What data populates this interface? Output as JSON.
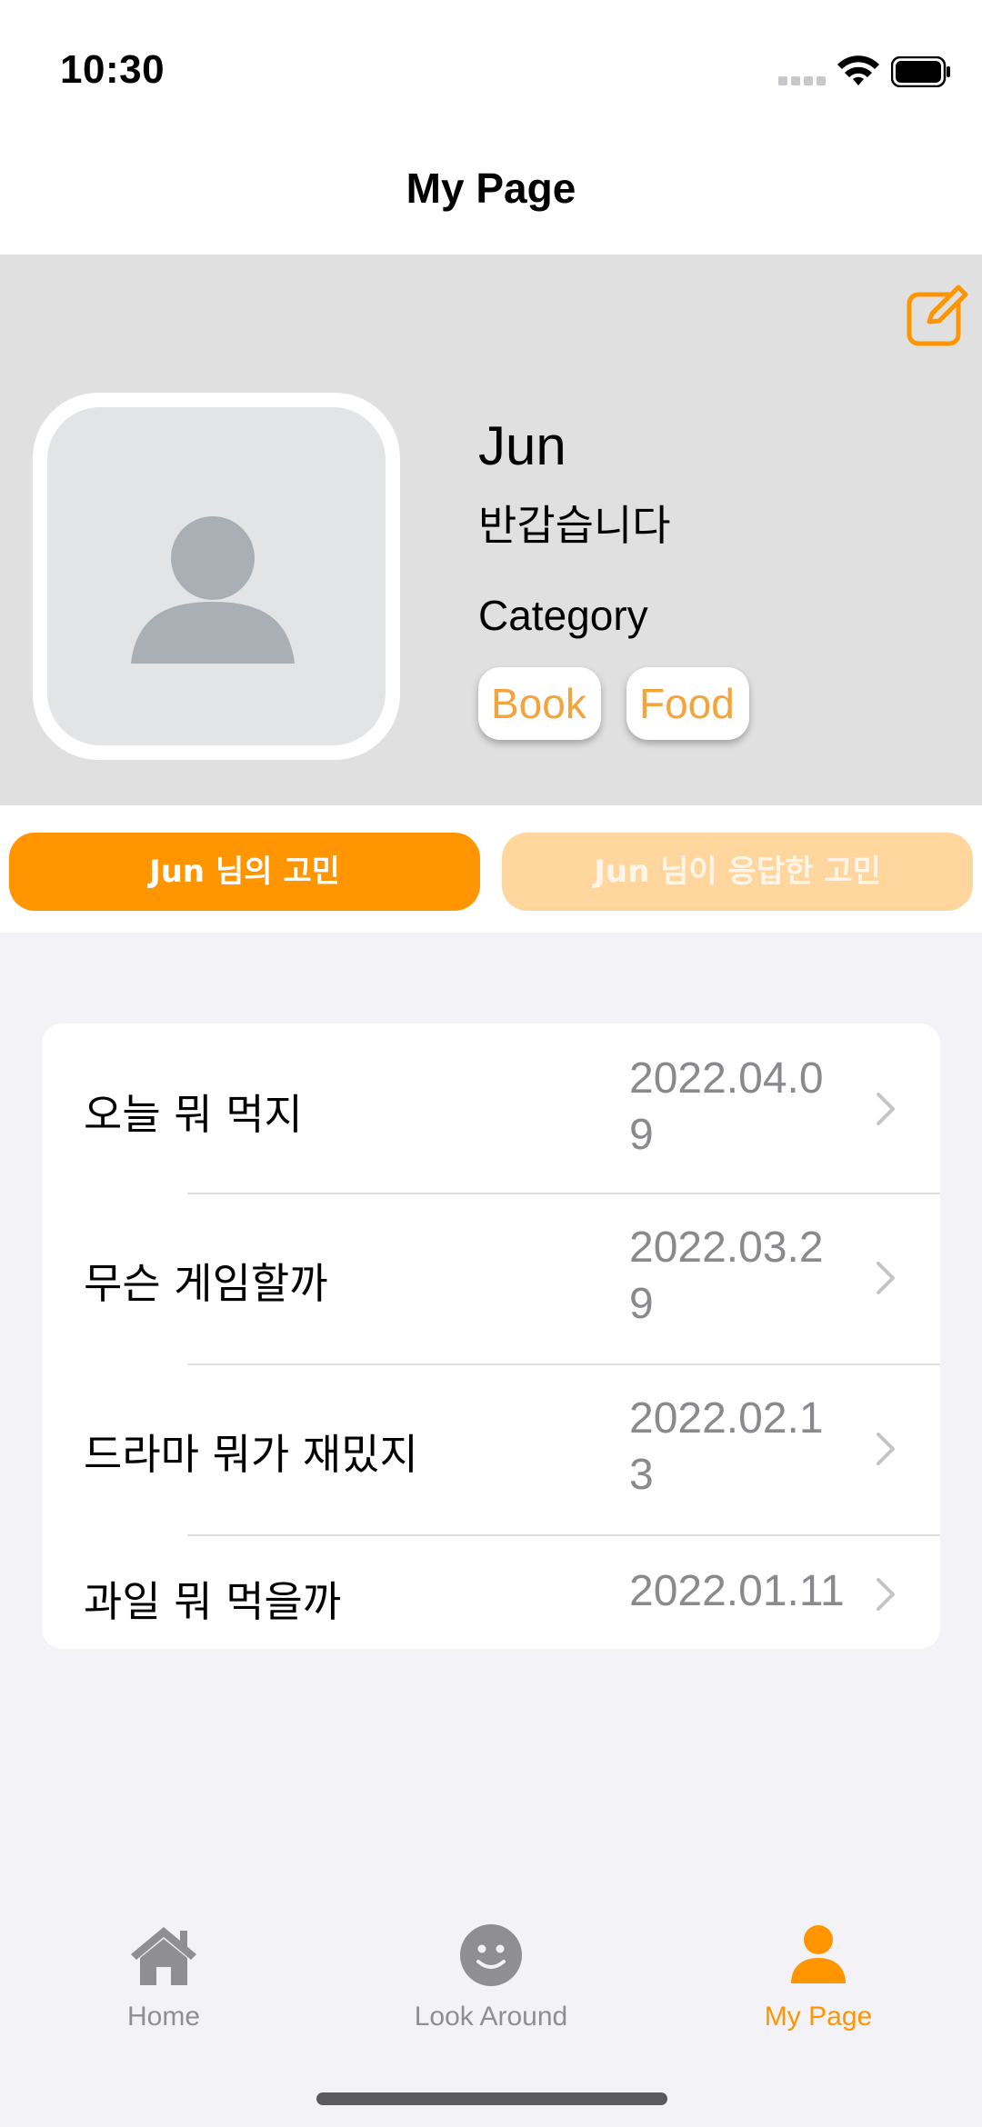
{
  "status_bar": {
    "time": "10:30"
  },
  "nav": {
    "title": "My Page"
  },
  "profile": {
    "name": "Jun",
    "greeting": "반갑습니다",
    "category_label": "Category",
    "categories": [
      "Book",
      "Food"
    ]
  },
  "segments": {
    "active_label": "Jun 님의 고민",
    "inactive_label": "Jun 님이 응답한 고민"
  },
  "posts": [
    {
      "title": "오늘 뭐 먹지",
      "date": "2022.04.09"
    },
    {
      "title": "무슨 게임할까",
      "date": "2022.03.29"
    },
    {
      "title": "드라마 뭐가 재밌지",
      "date": "2022.02.13"
    },
    {
      "title": "과일 뭐 먹을까",
      "date": "2022.01.11"
    }
  ],
  "tab_bar": {
    "items": [
      {
        "label": "Home",
        "icon": "home-icon"
      },
      {
        "label": "Look Around",
        "icon": "smiley-icon"
      },
      {
        "label": "My Page",
        "icon": "person-icon"
      }
    ],
    "selected": "My Page"
  },
  "colors": {
    "accent": "#ff9500",
    "accent_light": "#ffd79e",
    "chip_text": "#f4a43c",
    "profile_bg": "#e0e0e0"
  }
}
